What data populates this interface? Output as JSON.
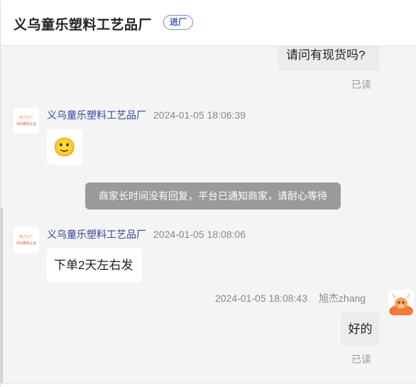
{
  "header": {
    "shop_name": "义乌童乐塑料工艺品厂",
    "enter_label": "进厂"
  },
  "messages": {
    "m1": {
      "text": "请问有现货吗?",
      "read": "已读"
    },
    "m2": {
      "sender": "义乌童乐塑料工艺品厂",
      "time": "2024-01-05 18:06:39",
      "emoji": "🙂"
    },
    "notice": "商家长时间没有回复，平台已通知商家，请耐心等待",
    "m3": {
      "sender": "义乌童乐塑料工艺品厂",
      "time": "2024-01-05 18:08:06",
      "text": "下单2天左右发"
    },
    "m4": {
      "time": "2024-01-05 18:08:43",
      "sender": "旭杰zhang",
      "text": "好的",
      "read": "已读"
    }
  },
  "shop_avatar": {
    "line1": "实力工厂",
    "line2": "365通前认证"
  },
  "colors": {
    "badge_border": "#6d8fd6",
    "sender_link": "#33449a",
    "notice_bg": "#9a9a9a"
  }
}
